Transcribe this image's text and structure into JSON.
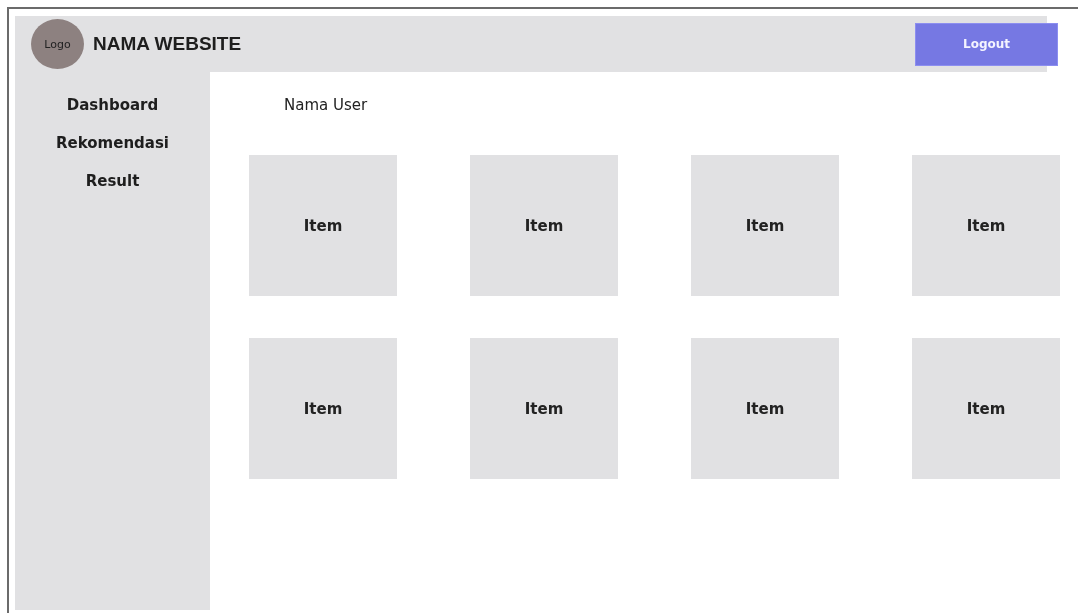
{
  "header": {
    "logo": "Logo",
    "title": "NAMA WEBSITE",
    "logout": "Logout"
  },
  "sidebar": {
    "items": [
      "Dashboard",
      "Rekomendasi",
      "Result"
    ]
  },
  "content": {
    "user_name": "Nama User",
    "items": [
      "Item",
      "Item",
      "Item",
      "Item",
      "Item",
      "Item",
      "Item",
      "Item"
    ]
  }
}
